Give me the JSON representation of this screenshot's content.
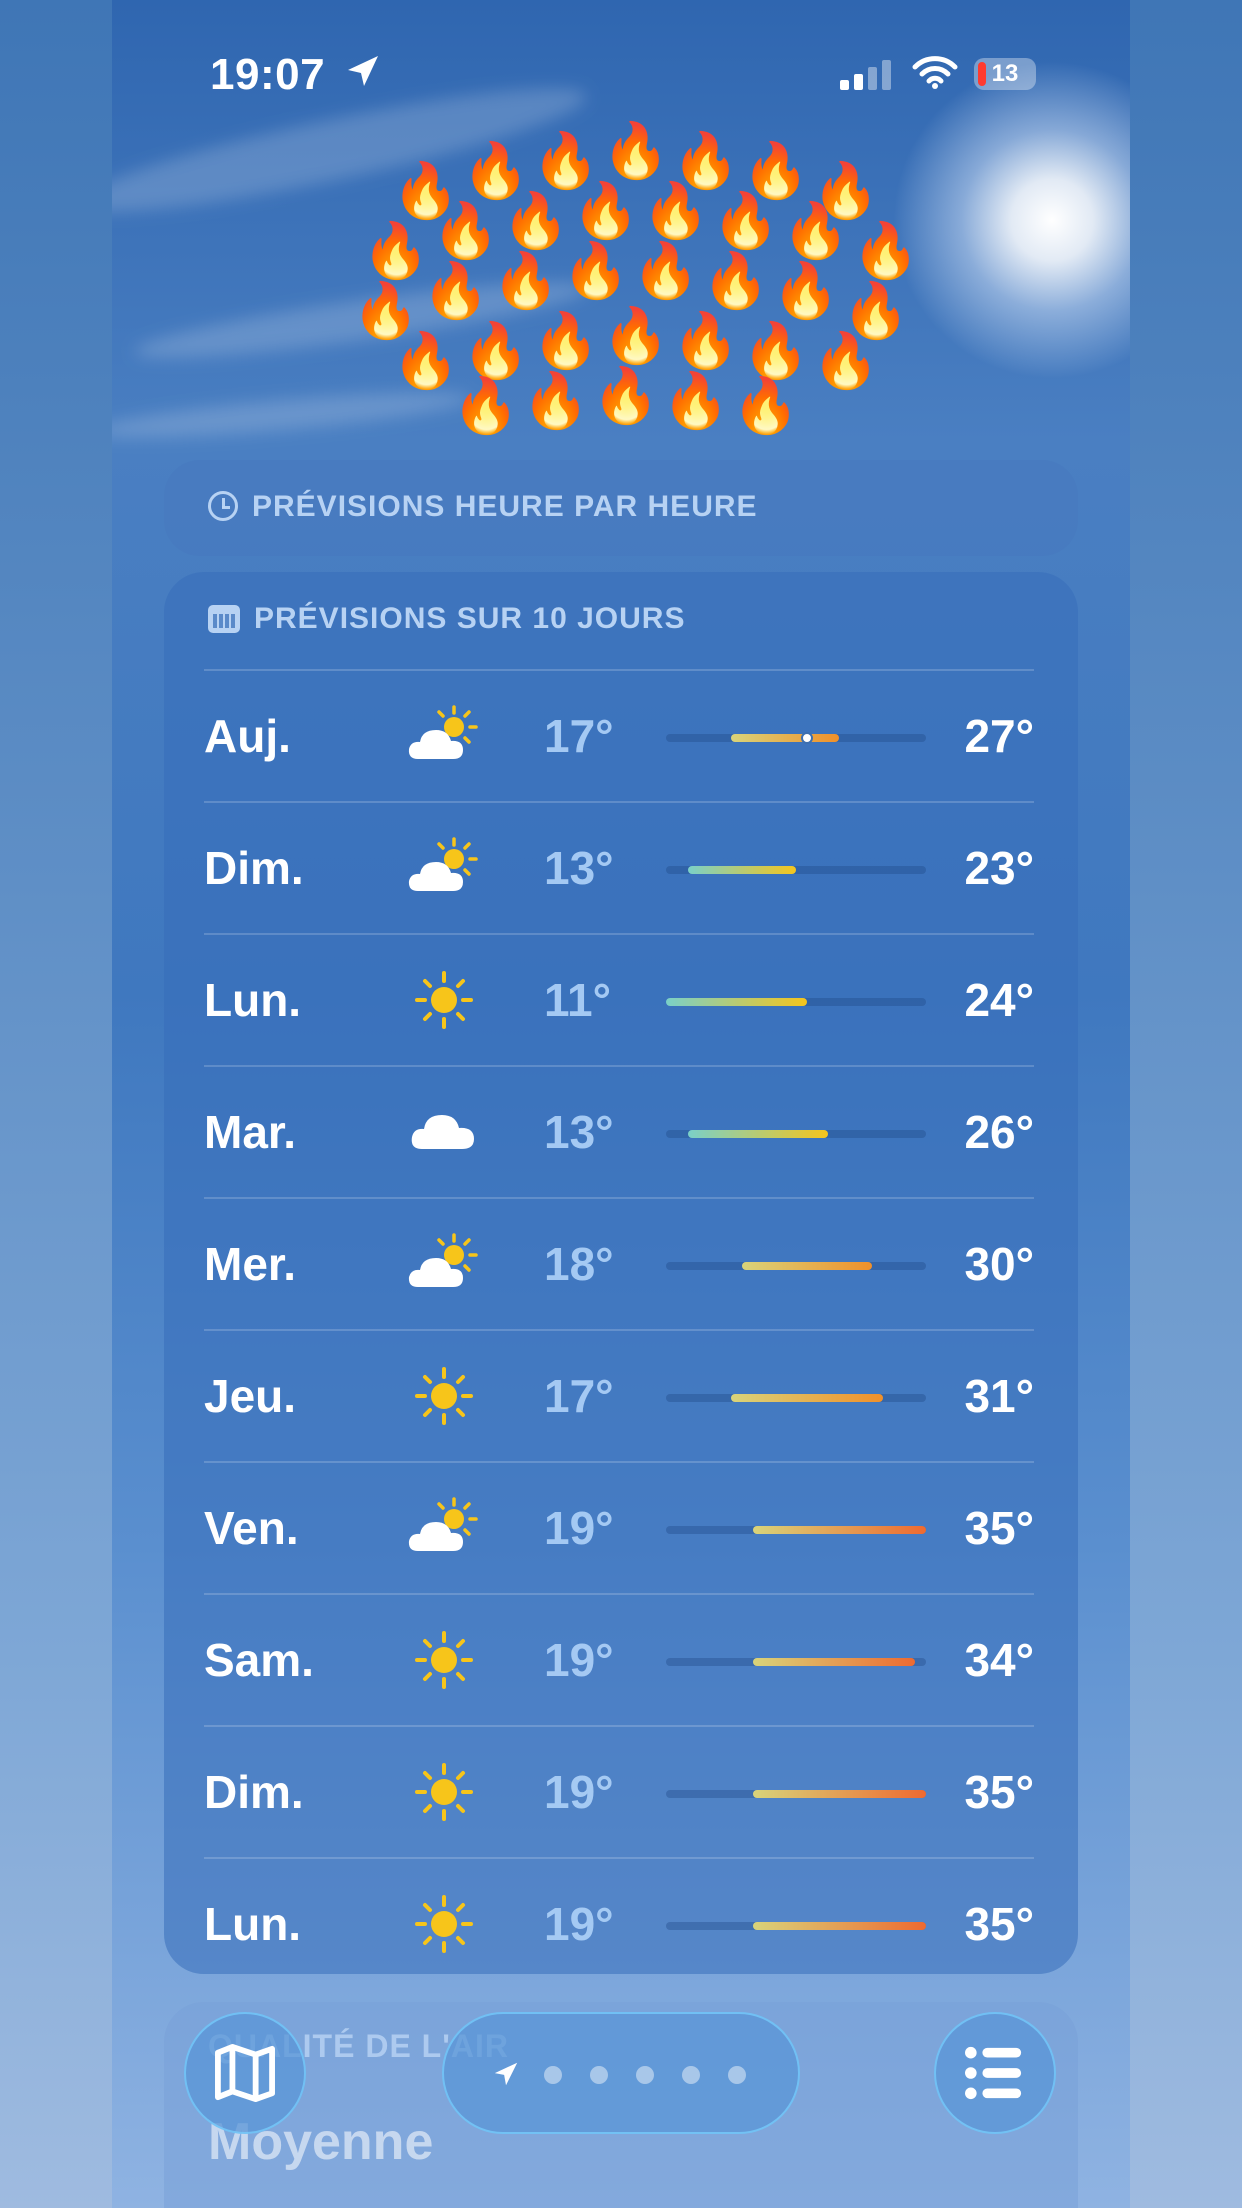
{
  "status_bar": {
    "time": "19:07",
    "battery": "13"
  },
  "hourly_card": {
    "title": "PRÉVISIONS HEURE PAR HEURE"
  },
  "ten_day_card": {
    "title": "PRÉVISIONS SUR 10 JOURS",
    "days": [
      {
        "day": "Auj.",
        "icon": "partly-sunny-icon",
        "low": "17°",
        "high": "27°",
        "range": [
          17,
          27
        ],
        "current": 24
      },
      {
        "day": "Dim.",
        "icon": "partly-sunny-icon",
        "low": "13°",
        "high": "23°",
        "range": [
          13,
          23
        ]
      },
      {
        "day": "Lun.",
        "icon": "sun-icon",
        "low": "11°",
        "high": "24°",
        "range": [
          11,
          24
        ]
      },
      {
        "day": "Mar.",
        "icon": "cloud-icon",
        "low": "13°",
        "high": "26°",
        "range": [
          13,
          26
        ]
      },
      {
        "day": "Mer.",
        "icon": "partly-sunny-icon",
        "low": "18°",
        "high": "30°",
        "range": [
          18,
          30
        ]
      },
      {
        "day": "Jeu.",
        "icon": "sun-icon",
        "low": "17°",
        "high": "31°",
        "range": [
          17,
          31
        ]
      },
      {
        "day": "Ven.",
        "icon": "partly-sunny-icon",
        "low": "19°",
        "high": "35°",
        "range": [
          19,
          35
        ]
      },
      {
        "day": "Sam.",
        "icon": "sun-icon",
        "low": "19°",
        "high": "34°",
        "range": [
          19,
          34
        ]
      },
      {
        "day": "Dim.",
        "icon": "sun-icon",
        "low": "19°",
        "high": "35°",
        "range": [
          19,
          35
        ]
      },
      {
        "day": "Lun.",
        "icon": "sun-icon",
        "low": "19°",
        "high": "35°",
        "range": [
          19,
          35
        ]
      }
    ],
    "scale_min": 11,
    "scale_max": 35
  },
  "air_card": {
    "title": "QUALITÉ DE L'AIR",
    "value": "Moyenne"
  },
  "tab_bar": {
    "page_count": 5,
    "icons": [
      "map-icon",
      "location-arrow-icon",
      "list-icon"
    ]
  },
  "colors": {
    "cool": "#7ad0c8",
    "mild": "#d9d47a",
    "warm": "#f5c51d",
    "hot": "#f0902a",
    "very_hot": "#ee6a30"
  }
}
